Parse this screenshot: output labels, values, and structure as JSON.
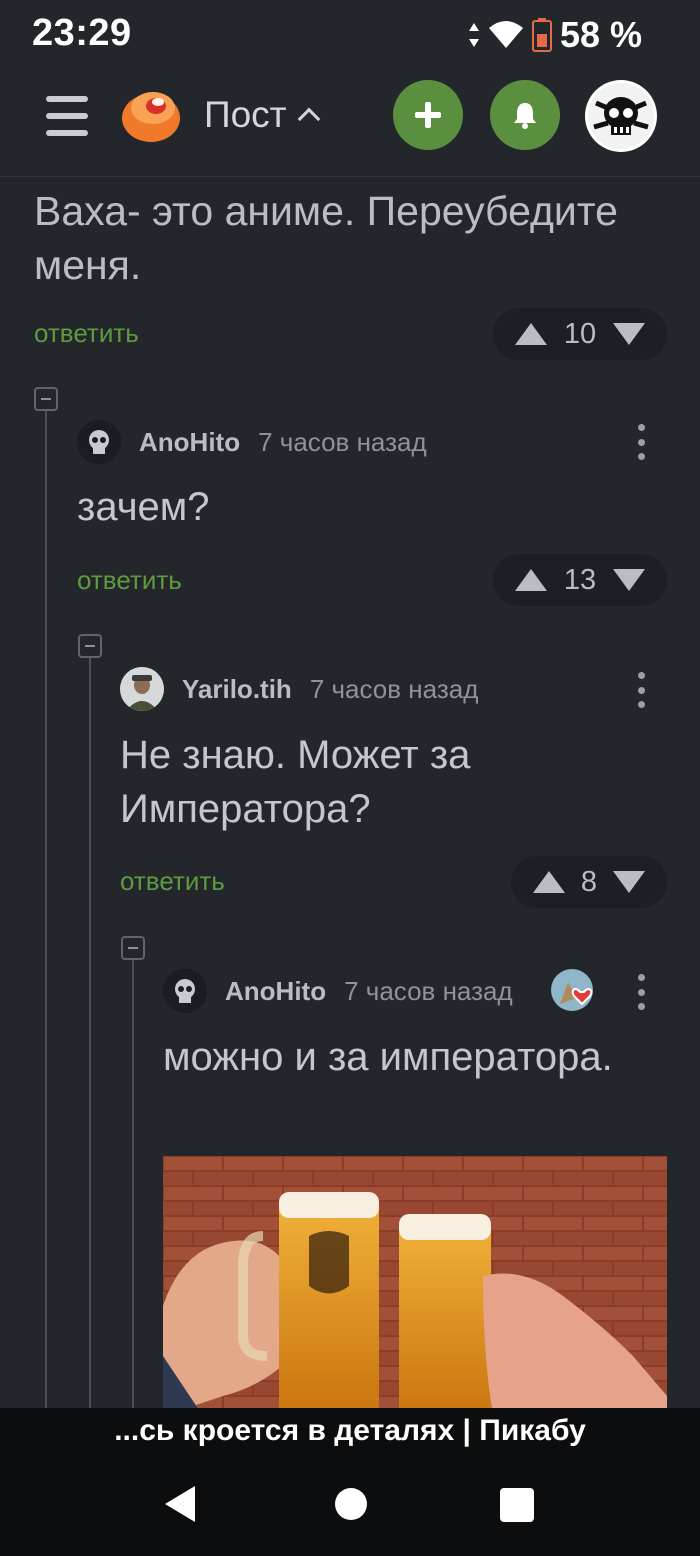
{
  "status_bar": {
    "time": "23:29",
    "battery": "58 %",
    "icons": [
      "data-arrows-icon",
      "wifi-icon",
      "battery-icon"
    ]
  },
  "header": {
    "title": "Пост",
    "menu_icon": "hamburger-icon",
    "logo": "pikabu-logo",
    "add_icon": "plus-icon",
    "bell_icon": "bell-icon",
    "accent_color": "#5a8f3f"
  },
  "post": {
    "text": "Ваха- это аниме. Переубедите меня.",
    "reply_label": "ответить",
    "votes": "10"
  },
  "comments": [
    {
      "author": "AnoHito",
      "time": "7 часов назад",
      "text": "зачем?",
      "reply_label": "ответить",
      "votes": "13"
    },
    {
      "author": "Yarilo.tih",
      "time": "7 часов назад",
      "text": "Не знаю. Может за Императора?",
      "reply_label": "ответить",
      "votes": "8"
    },
    {
      "author": "AnoHito",
      "time": "7 часов назад",
      "text": "можно и за императора.",
      "image": "beer-mugs-toast-image"
    }
  ],
  "bottom_title": "...сь кроется в деталях | Пикабу",
  "nav": {
    "back": "back-icon",
    "home": "home-icon",
    "recents": "recents-icon"
  }
}
